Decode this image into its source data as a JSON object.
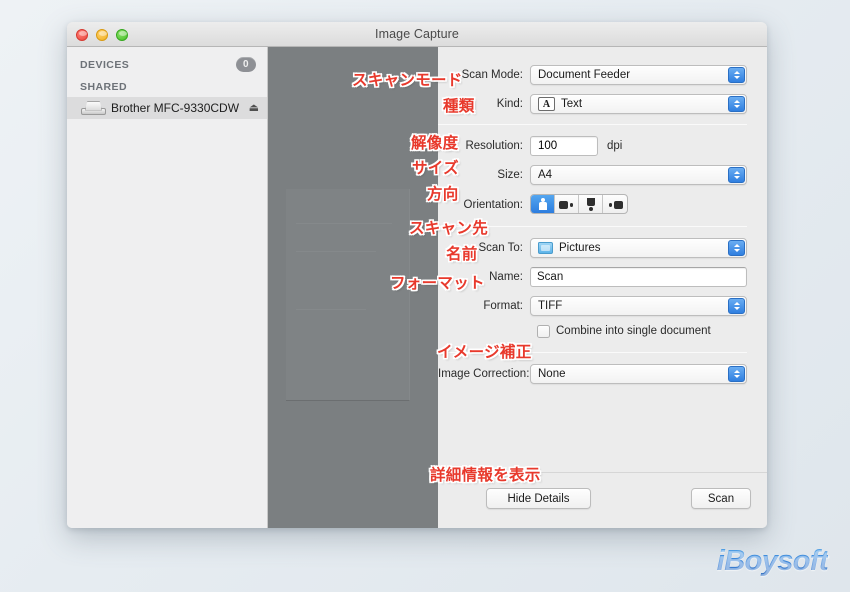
{
  "window": {
    "title": "Image Capture",
    "traffic_lights": [
      "close-red",
      "minimize-yellow",
      "zoom-green"
    ]
  },
  "sidebar": {
    "devices_header": "DEVICES",
    "devices_badge": "0",
    "shared_header": "SHARED",
    "device": {
      "name": "Brother MFC-9330CDW",
      "eject_glyph": "⏏"
    }
  },
  "settings": {
    "scan_mode": {
      "label": "Scan Mode:",
      "value": "Document Feeder"
    },
    "kind": {
      "label": "Kind:",
      "value": "Text",
      "glyph": "A"
    },
    "resolution": {
      "label": "Resolution:",
      "value": "100",
      "unit": "dpi"
    },
    "size": {
      "label": "Size:",
      "value": "A4"
    },
    "orientation": {
      "label": "Orientation:",
      "selected_index": 0,
      "options": [
        "portrait-up",
        "landscape-right",
        "portrait-down",
        "landscape-left"
      ]
    },
    "scan_to": {
      "label": "Scan To:",
      "value": "Pictures"
    },
    "name": {
      "label": "Name:",
      "value": "Scan"
    },
    "format": {
      "label": "Format:",
      "value": "TIFF"
    },
    "combine": {
      "label": "Combine into single document",
      "checked": false
    },
    "image_correction": {
      "label": "Image Correction:",
      "value": "None"
    }
  },
  "footer": {
    "hide_details": "Hide Details",
    "scan": "Scan"
  },
  "annotations": {
    "scan_mode": "スキャンモード",
    "kind": "種類",
    "resolution": "解像度",
    "size": "サイズ",
    "orientation": "方向",
    "scan_to": "スキャン先",
    "name": "名前",
    "format": "フォーマット",
    "image_correction": "イメージ補正",
    "hide_details": "詳細情報を表示"
  },
  "watermark": {
    "text": "iBoysoft"
  },
  "colors": {
    "accent_blue": "#2c7ddf",
    "annotation_red": "#e8392c",
    "preview_gray": "#7b7f81",
    "window_bg": "#ececec"
  }
}
